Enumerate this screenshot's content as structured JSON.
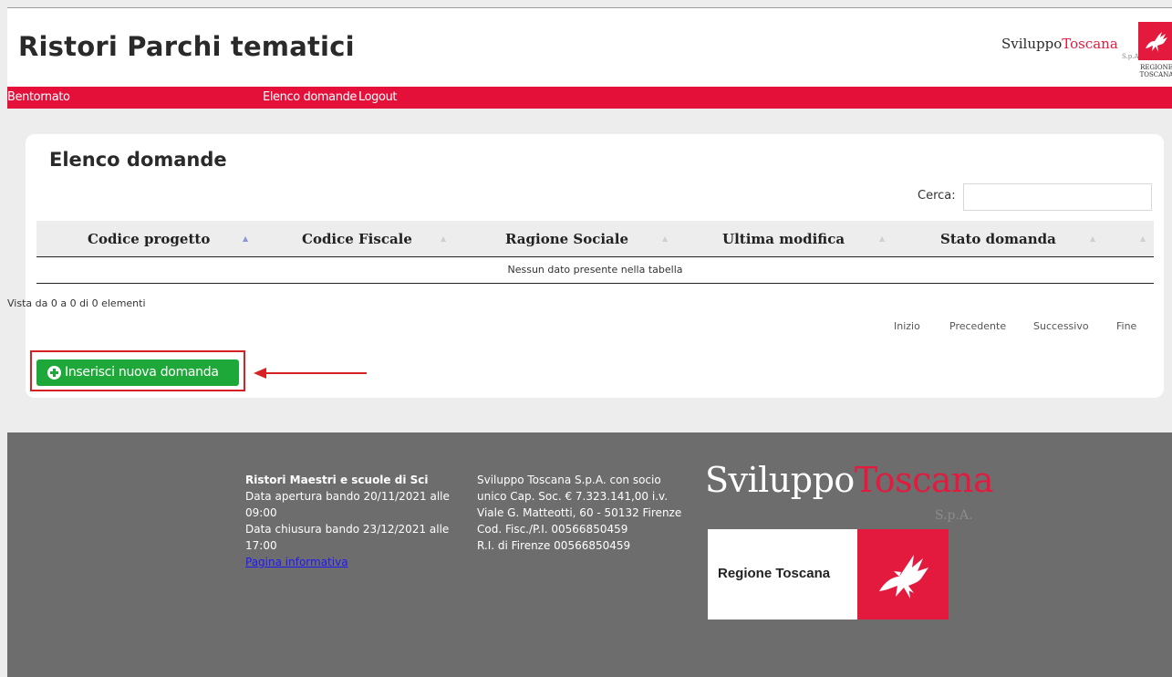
{
  "header": {
    "title": "Ristori Parchi tematici",
    "brand_part1": "Sviluppo",
    "brand_part2": "Toscana",
    "brand_suffix": "S.p.A.",
    "region_line1": "REGIONE",
    "region_line2": "TOSCANA"
  },
  "nav": {
    "items": [
      {
        "label": "Bentornato"
      },
      {
        "label": "Elenco domande"
      },
      {
        "label": "Logout"
      }
    ]
  },
  "panel": {
    "title": "Elenco domande",
    "search": {
      "label": "Cerca:",
      "value": "",
      "placeholder": ""
    },
    "table": {
      "columns": [
        {
          "label": "Codice progetto",
          "sort": "ascending"
        },
        {
          "label": "Codice Fiscale",
          "sort": "none"
        },
        {
          "label": "Ragione Sociale",
          "sort": "none"
        },
        {
          "label": "Ultima modifica",
          "sort": "none"
        },
        {
          "label": "Stato domanda",
          "sort": "none"
        }
      ],
      "empty_message": "Nessun dato presente nella tabella"
    },
    "info": "Vista da 0 a 0 di 0 elementi",
    "pagination": [
      "Inizio",
      "Precedente",
      "Successivo",
      "Fine"
    ],
    "insert_button": "Inserisci nuova domanda"
  },
  "footer": {
    "col1": {
      "title": "Ristori Maestri e scuole di Sci",
      "lines": [
        "Data apertura bando 20/11/2021 alle",
        "09:00",
        "Data chiusura bando 23/12/2021 alle",
        "17:00"
      ],
      "link": "Pagina informativa"
    },
    "col2": {
      "lines": [
        "Sviluppo Toscana S.p.A. con socio",
        "unico Cap. Soc. € 7.323.141,00 i.v.",
        "Viale G. Matteotti, 60 - 50132 Firenze",
        "Cod. Fisc./P.I. 00566850459",
        "R.I. di Firenze 00566850459"
      ]
    },
    "brand_part1": "Sviluppo",
    "brand_part2": "Toscana",
    "brand_suffix": "S.p.A.",
    "region_label": "Regione Toscana"
  },
  "colors": {
    "nav_red": "#e4103a",
    "brand_red": "#e4193e",
    "button_green": "#1fa83a",
    "footer_gray": "#6d6d6d",
    "annotation_red": "#d62222"
  }
}
